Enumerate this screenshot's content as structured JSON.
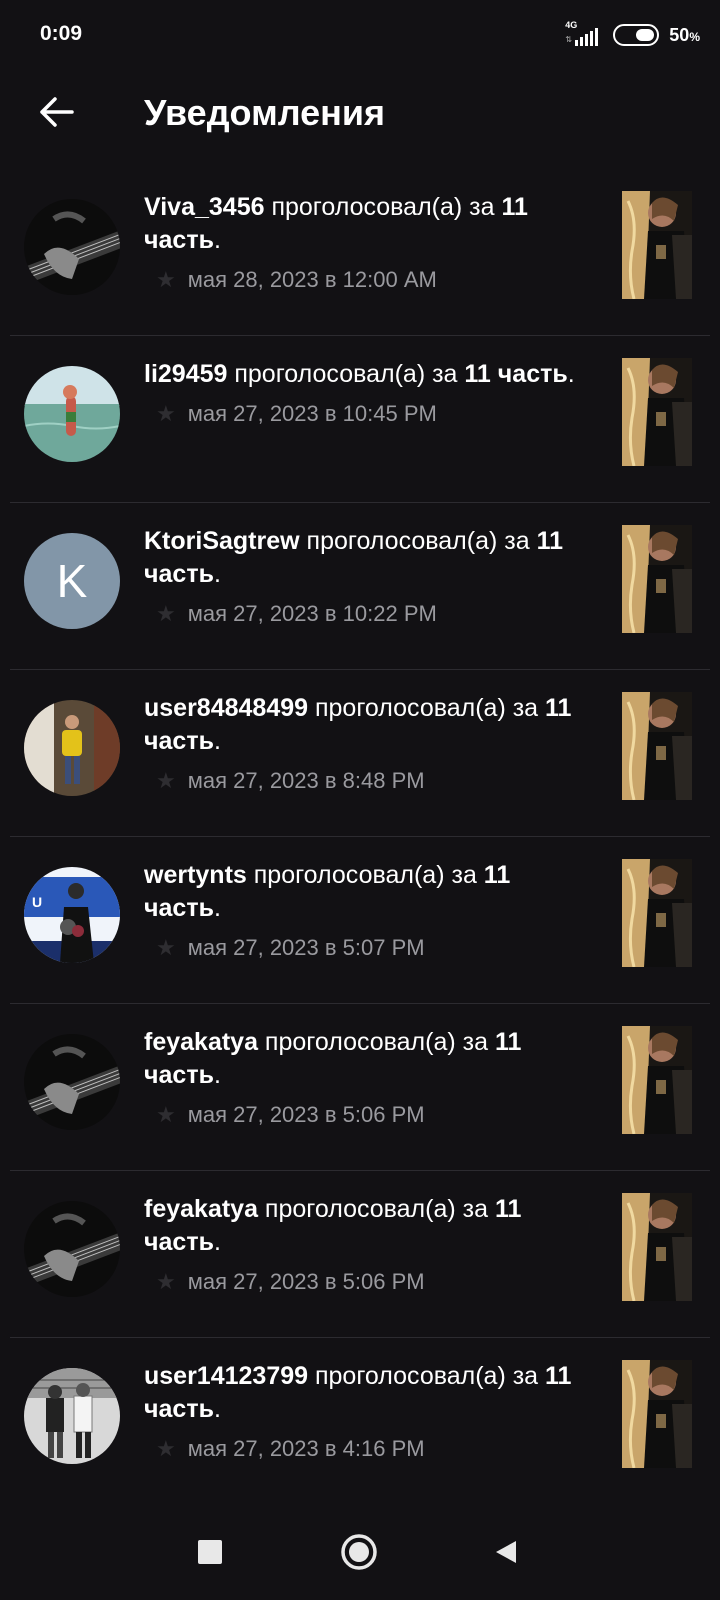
{
  "status_bar": {
    "time": "0:09",
    "network": "4G",
    "battery_percent": "50",
    "battery_unit": "%",
    "battery_level": 0.5
  },
  "header": {
    "back_icon": "arrow-left-icon",
    "title": "Уведомления"
  },
  "notifications": [
    {
      "username": "Viva_3456",
      "action": " проголосовал(а) за ",
      "part": "11 часть",
      "suffix": ".",
      "timestamp": "мая 28, 2023 в 12:00 AM",
      "avatar_type": "guitar"
    },
    {
      "username": "li29459",
      "action": " проголосовал(а) за ",
      "part": "11 часть",
      "suffix": ".",
      "timestamp": "мая 27, 2023 в 10:45 PM",
      "avatar_type": "sea"
    },
    {
      "username": "KtoriSagtrew",
      "action": " проголосовал(а) за ",
      "part": "11 часть",
      "suffix": ".",
      "timestamp": "мая 27, 2023 в 10:22 PM",
      "avatar_type": "letter",
      "avatar_letter": "K"
    },
    {
      "username": "user84848499",
      "action": " проголосовал(а) за ",
      "part": "11 часть",
      "suffix": ".",
      "timestamp": "мая 27, 2023 в 8:48 PM",
      "avatar_type": "room"
    },
    {
      "username": "wertynts",
      "action": " проголосовал(а) за ",
      "part": "11 часть",
      "suffix": ".",
      "timestamp": "мая 27, 2023 в 5:07 PM",
      "avatar_type": "stage"
    },
    {
      "username": "feyakatya",
      "action": " проголосовал(а) за ",
      "part": "11 часть",
      "suffix": ".",
      "timestamp": "мая 27, 2023 в 5:06 PM",
      "avatar_type": "guitar"
    },
    {
      "username": "feyakatya",
      "action": " проголосовал(а) за ",
      "part": "11 часть",
      "suffix": ".",
      "timestamp": "мая 27, 2023 в 5:06 PM",
      "avatar_type": "guitar"
    },
    {
      "username": "user14123799",
      "action": " проголосовал(а) за ",
      "part": "11 часть",
      "suffix": ".",
      "timestamp": "мая 27, 2023 в 4:16 PM",
      "avatar_type": "bw"
    }
  ],
  "colors": {
    "background": "#121114",
    "divider": "#2c2b30",
    "timestamp": "#9a9a9f",
    "letter_avatar": "#8296a8"
  },
  "nav_bar": {
    "recents_icon": "square-icon",
    "home_icon": "circle-icon",
    "back_icon": "triangle-back-icon"
  }
}
